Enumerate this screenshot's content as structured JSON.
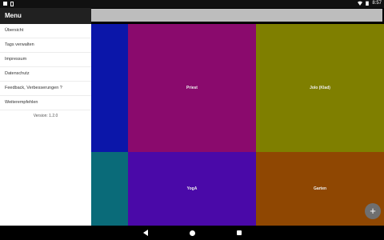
{
  "status_bar": {
    "time": "8:57",
    "icons": [
      "notification-icon",
      "notification-icon",
      "wifi-icon",
      "battery-icon"
    ]
  },
  "drawer": {
    "title": "Menu",
    "items": [
      {
        "label": "Übersicht"
      },
      {
        "label": "Tags verwalten"
      },
      {
        "label": "Impressum"
      },
      {
        "label": "Datenschutz"
      },
      {
        "label": "Feedback, Verbesserungen ?"
      },
      {
        "label": "Weiterempfehlen"
      }
    ],
    "version": "Version: 1.2.0"
  },
  "tiles": [
    {
      "label": "",
      "color": "#0b16a9"
    },
    {
      "label": "Priest",
      "color": "#8a0a6d"
    },
    {
      "label": "Jolo (Klad)",
      "color": "#7f7f00"
    },
    {
      "label": "",
      "color": "#0a6b79"
    },
    {
      "label": "YogA",
      "color": "#4a09a8"
    },
    {
      "label": "Garten",
      "color": "#8f4702"
    }
  ],
  "fab": {
    "label": "+"
  },
  "colors": {
    "drawer_header": "#212121",
    "search_bar": "#bdbdbd",
    "fab": "#6f6f6f"
  }
}
